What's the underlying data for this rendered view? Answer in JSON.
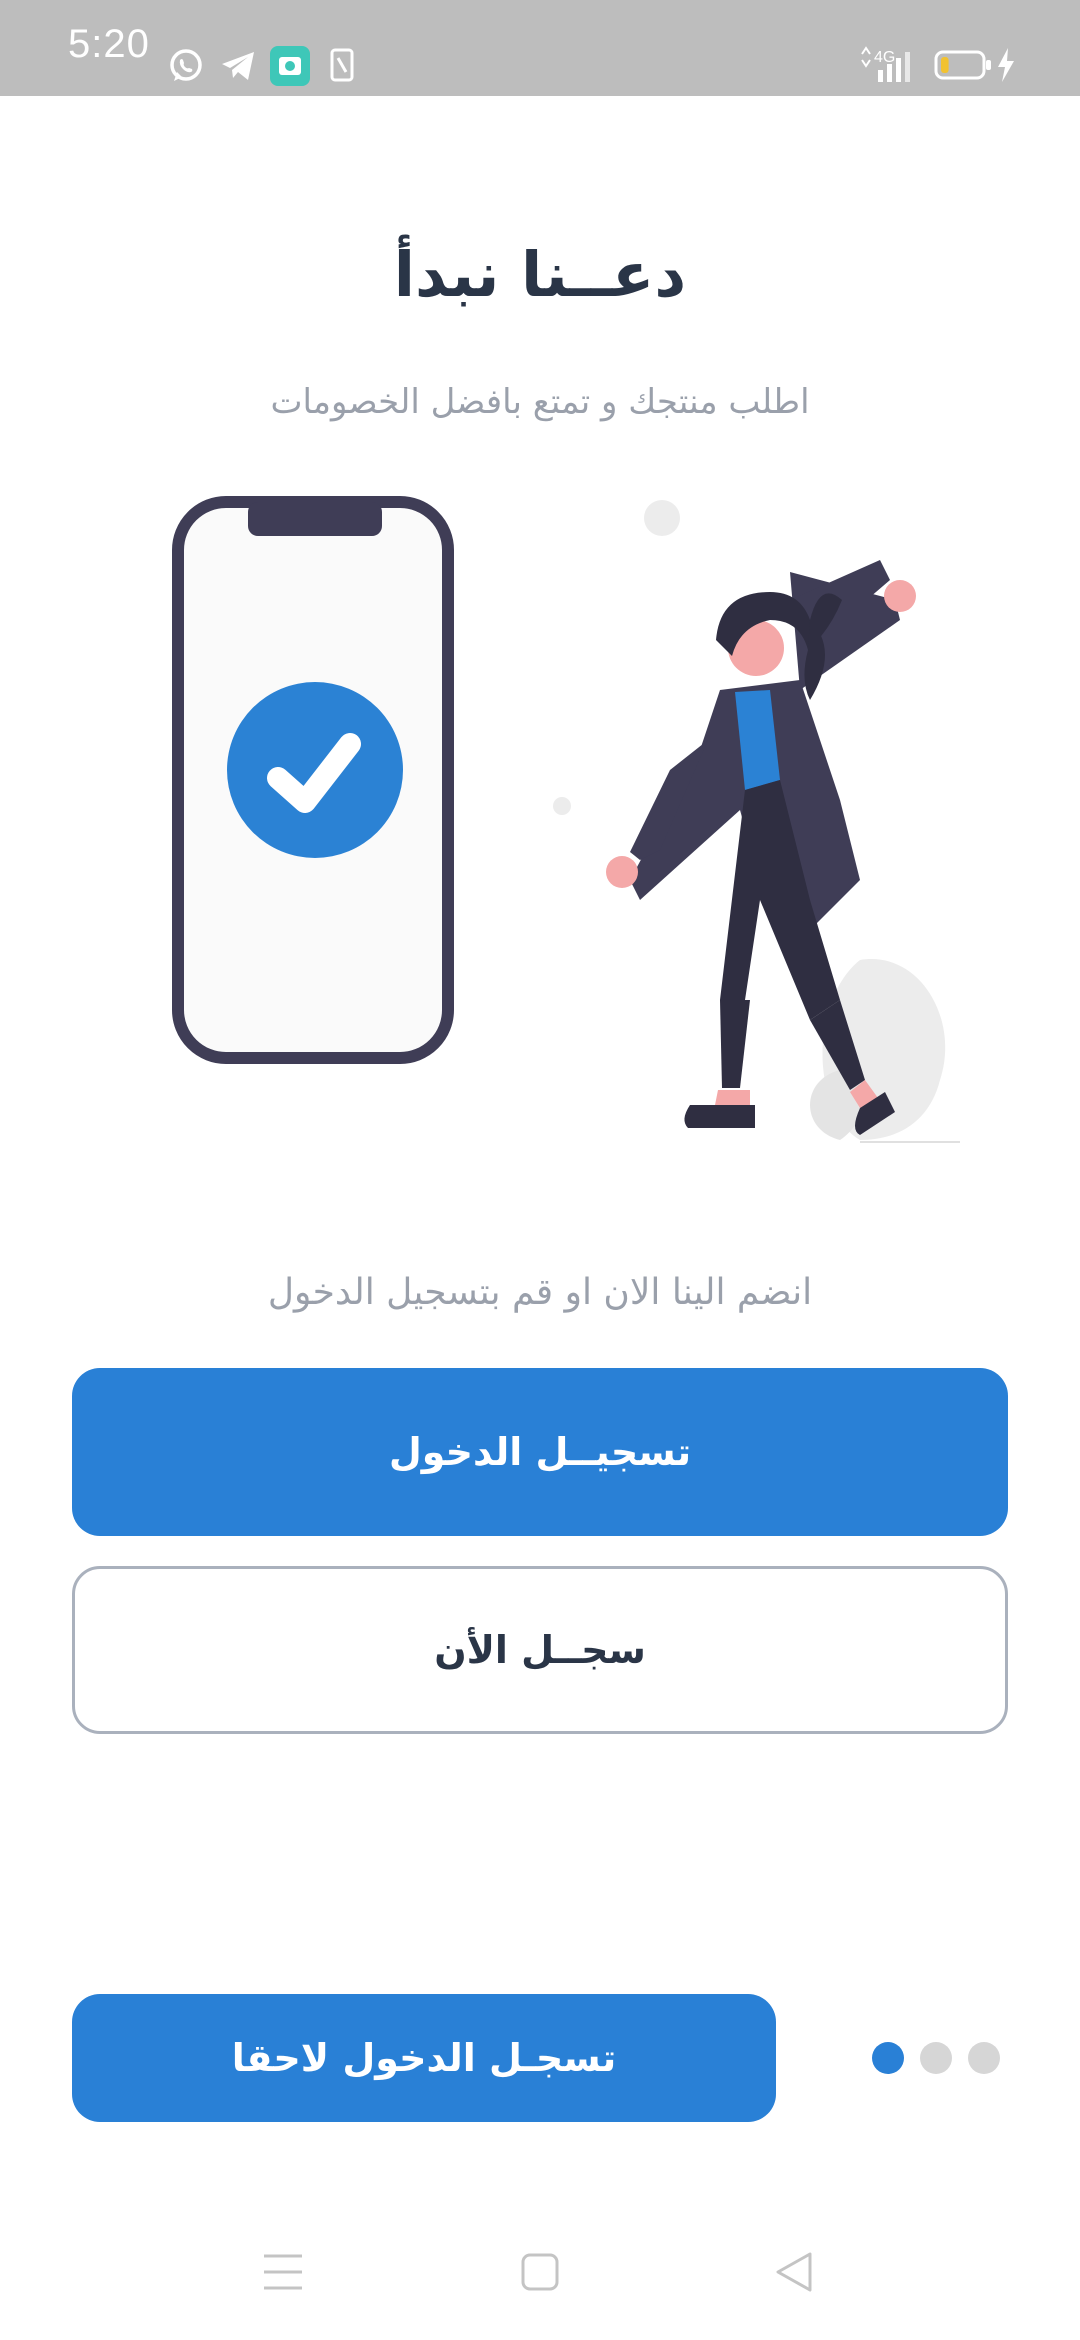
{
  "status_bar": {
    "time": "5:20",
    "network": "4G",
    "icons": [
      "whatsapp-icon",
      "telegram-icon",
      "screen-recorder-icon",
      "sim-icon"
    ],
    "battery_level": 0.2
  },
  "onboarding": {
    "title": "دعــنا نبدأ",
    "subtitle": "اطلب منتجك و تمتع بافضل الخصومات",
    "join_text": "انضم الينا الان او قم بتسجيل الدخول",
    "login_label": "تسجيــل الدخول",
    "register_label": "سجــل الأن",
    "later_label": "تسجـل الدخول لاحقا",
    "page_count": 3,
    "active_page": 1
  },
  "colors": {
    "accent": "#2980d6",
    "title": "#2a3547",
    "muted": "#9aa0ab"
  },
  "nav_bar": {
    "icons": [
      "menu-icon",
      "home-square-icon",
      "back-triangle-icon"
    ]
  }
}
